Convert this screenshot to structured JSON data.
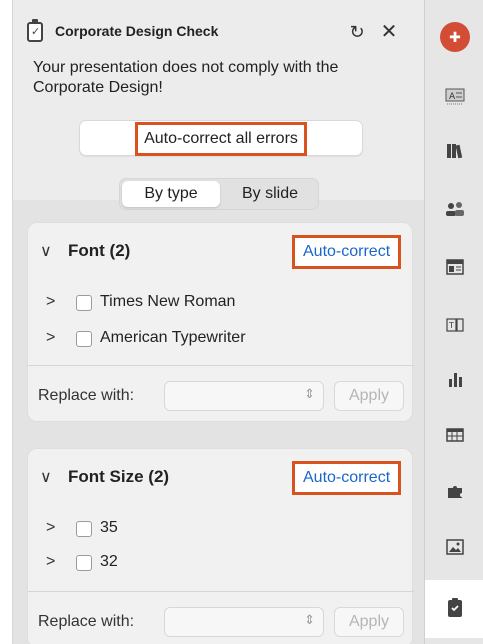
{
  "header": {
    "title": "Corporate Design Check",
    "message": "Your presentation does not comply with the Corporate Design!",
    "autocorrect_all": "Auto-correct all errors"
  },
  "view_toggle": {
    "options": [
      "By type",
      "By slide"
    ],
    "selected": "By type"
  },
  "sections": [
    {
      "title": "Font (2)",
      "autocorrect": "Auto-correct",
      "items": [
        "Times New Roman",
        "American Typewriter"
      ],
      "replace_label": "Replace with:",
      "apply": "Apply"
    },
    {
      "title": "Font Size (2)",
      "autocorrect": "Auto-correct",
      "items": [
        "35",
        "32"
      ],
      "replace_label": "Replace with:",
      "apply": "Apply"
    }
  ],
  "colors": {
    "highlight": "#d9531e",
    "link": "#1a67c9",
    "logo": "#d34d36"
  },
  "rail_icons": [
    "logo-icon",
    "text-box-icon",
    "library-icon",
    "people-icon",
    "layout-icon",
    "text-frame-icon",
    "bar-chart-icon",
    "table-icon",
    "puzzle-icon",
    "image-icon",
    "check-clipboard-icon"
  ]
}
